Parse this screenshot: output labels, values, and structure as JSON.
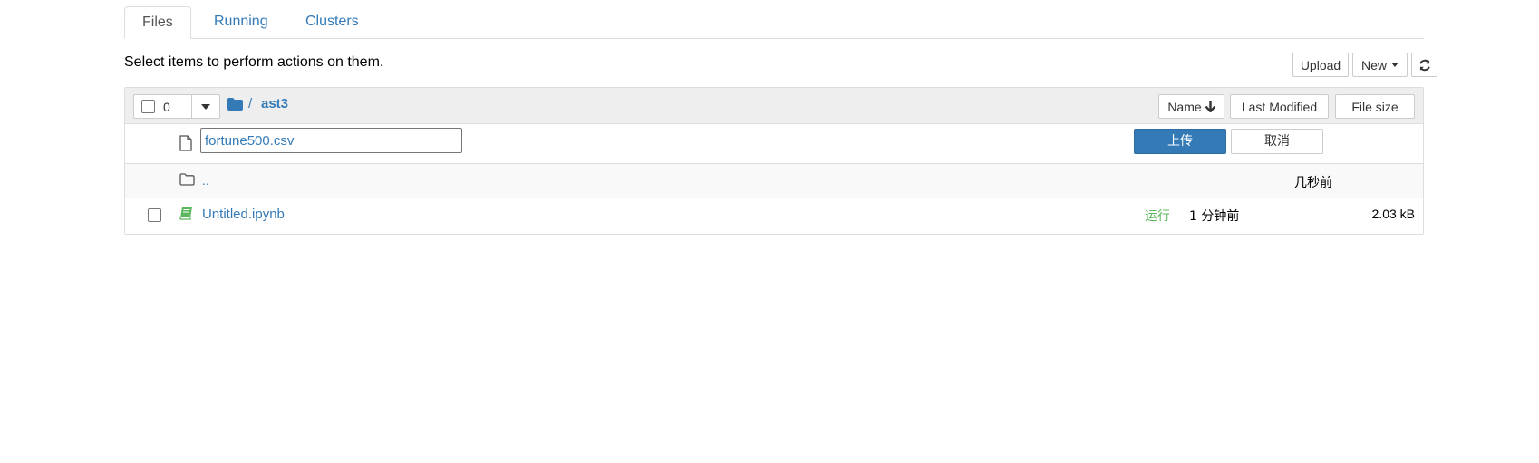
{
  "tabs": [
    {
      "label": "Files",
      "active": true
    },
    {
      "label": "Running",
      "active": false
    },
    {
      "label": "Clusters",
      "active": false
    }
  ],
  "toolbar": {
    "hint": "Select items to perform actions on them.",
    "upload_label": "Upload",
    "new_label": "New",
    "refresh_icon": "refresh-icon"
  },
  "list_header": {
    "selected_count": "0",
    "breadcrumb_root": "/",
    "breadcrumb_folder": "ast3",
    "sort_name_label": "Name",
    "sort_modified_label": "Last Modified",
    "sort_size_label": "File size"
  },
  "upload_row": {
    "filename": "fortune500.csv",
    "upload_button": "上传",
    "cancel_button": "取消"
  },
  "parent_row": {
    "name": "..",
    "modified": "几秒前"
  },
  "items": [
    {
      "name": "Untitled.ipynb",
      "status": "运行",
      "modified": "1 分钟前",
      "size": "2.03 kB",
      "icon": "notebook-icon"
    }
  ],
  "colors": {
    "link": "#337ab7",
    "running": "#5cb85c",
    "notebook_icon": "#5cb85c",
    "header_bg": "#eeeeee",
    "primary_button": "#337ab7"
  }
}
